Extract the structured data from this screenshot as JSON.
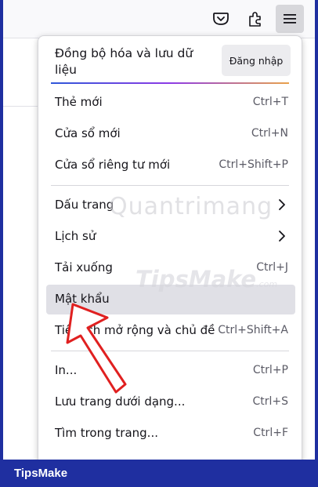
{
  "menu": {
    "sync_text": "Đồng bộ hóa và lưu dữ liệu",
    "signin_label": "Đăng nhập",
    "items": [
      {
        "label": "Thẻ mới",
        "shortcut": "Ctrl+T"
      },
      {
        "label": "Cửa sổ mới",
        "shortcut": "Ctrl+N"
      },
      {
        "label": "Cửa sổ riêng tư mới",
        "shortcut": "Ctrl+Shift+P"
      },
      {
        "label": "Dấu trang",
        "shortcut": ""
      },
      {
        "label": "Lịch sử",
        "shortcut": ""
      },
      {
        "label": "Tải xuống",
        "shortcut": "Ctrl+J"
      },
      {
        "label": "Mật khẩu",
        "shortcut": ""
      },
      {
        "label": "Tiện ích mở rộng và chủ đề",
        "shortcut": "Ctrl+Shift+A"
      },
      {
        "label": "In...",
        "shortcut": "Ctrl+P"
      },
      {
        "label": "Lưu trang dưới dạng...",
        "shortcut": "Ctrl+S"
      },
      {
        "label": "Tìm trong trang...",
        "shortcut": "Ctrl+F"
      }
    ]
  },
  "toolbar": {
    "icons": [
      "pocket-icon",
      "extensions-icon",
      "hamburger-menu-icon"
    ]
  },
  "watermarks": {
    "quantrimang": "Quantrimang",
    "tipsmake": "TipsMake",
    "tipsmake_suffix": ".com"
  },
  "footer": {
    "logo": "TipsMake"
  },
  "colors": {
    "highlight_row": "#e0e0e6",
    "arrow": "#e02020",
    "footer_bg": "#1f2fa0"
  }
}
